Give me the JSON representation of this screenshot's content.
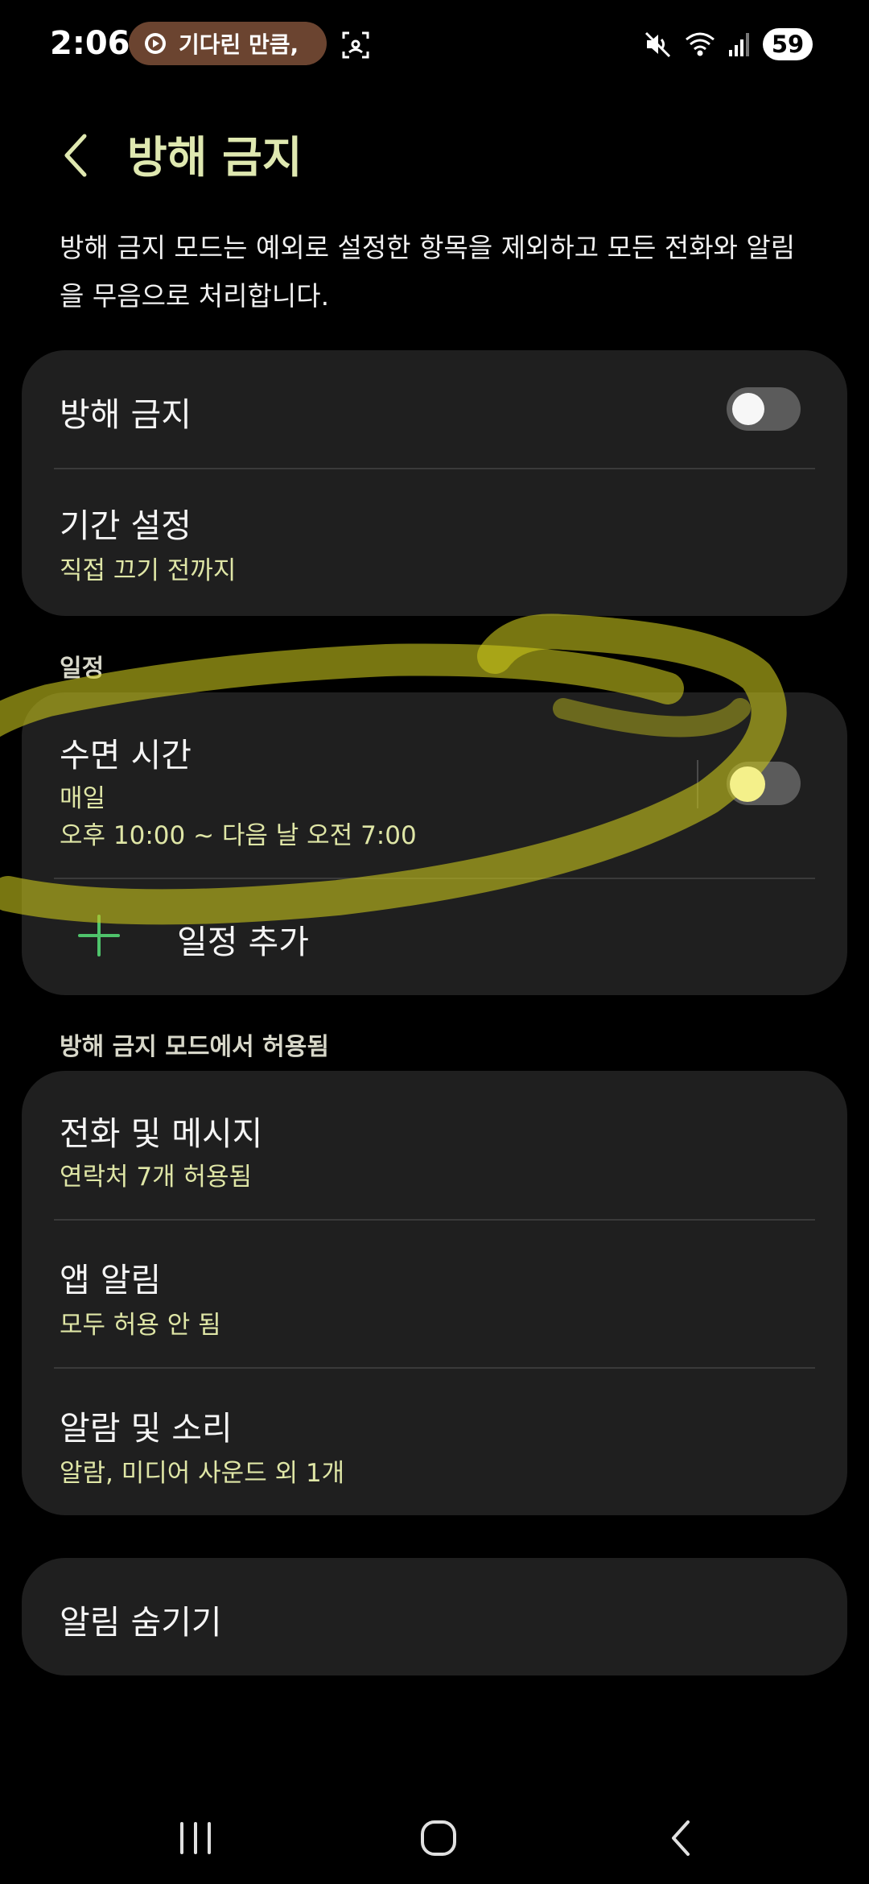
{
  "status_bar": {
    "time": "2:06",
    "media_text": "기다린 만큼,",
    "battery": "59"
  },
  "header": {
    "title": "방해 금지",
    "description": "방해 금지 모드는 예외로 설정한 항목을 제외하고 모든 전화와 알림을 무음으로 처리합니다."
  },
  "main_card": {
    "dnd_label": "방해 금지",
    "dnd_enabled": false,
    "duration_title": "기간 설정",
    "duration_value": "직접 끄기 전까지"
  },
  "schedule": {
    "section_label": "일정",
    "items": [
      {
        "title": "수면 시간",
        "repeat": "매일",
        "time_range": "오후 10:00 ~ 다음 날 오전 7:00",
        "enabled": false
      }
    ],
    "add_label": "일정 추가"
  },
  "allowed": {
    "section_label": "방해 금지 모드에서 허용됨",
    "items": [
      {
        "title": "전화 및 메시지",
        "subtitle": "연락처 7개 허용됨"
      },
      {
        "title": "앱 알림",
        "subtitle": "모두 허용 안 됨"
      },
      {
        "title": "알람 및 소리",
        "subtitle": "알람, 미디어 사운드 외 1개"
      }
    ]
  },
  "hide_notifications": {
    "title": "알림 숨기기"
  },
  "colors": {
    "accent": "#dfe8b0",
    "card": "#1f1f1f",
    "highlight": "#d7d21e",
    "plus": "#4fc36b"
  },
  "icons": {
    "back": "chevron-left-icon",
    "play": "play-icon",
    "screenshot": "screen-capture-icon",
    "mute": "mute-icon",
    "wifi": "wifi-icon",
    "signal": "signal-icon",
    "add": "plus-icon",
    "nav_recent": "recent-apps-icon",
    "nav_home": "home-icon",
    "nav_back": "back-icon"
  }
}
